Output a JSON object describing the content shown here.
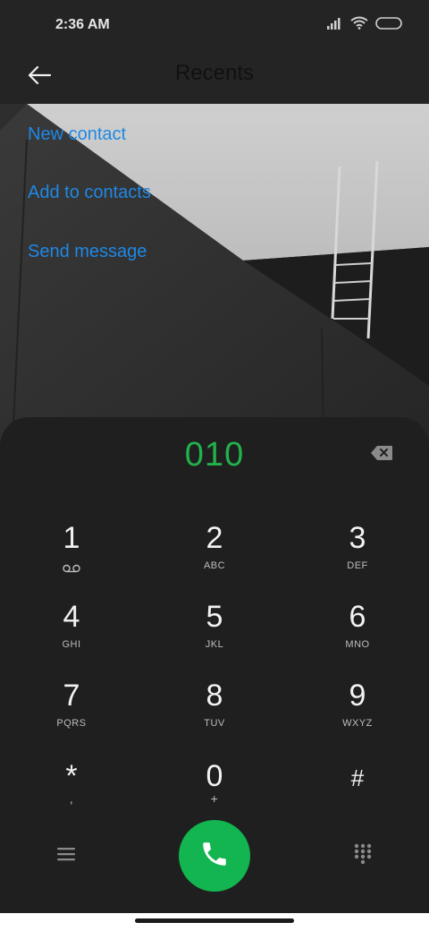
{
  "status_bar": {
    "time": "2:36 AM",
    "icons": [
      "signal-icon",
      "wifi-icon",
      "battery-icon"
    ]
  },
  "app_bar": {
    "title": "Recents",
    "back_icon": "back-arrow-icon"
  },
  "actions": {
    "new_contact": "New contact",
    "add_to_contacts": "Add to contacts",
    "send_message": "Send message"
  },
  "dialer": {
    "number": "010",
    "keys": [
      {
        "digit": "1",
        "sub": ""
      },
      {
        "digit": "2",
        "sub": "ABC"
      },
      {
        "digit": "3",
        "sub": "DEF"
      },
      {
        "digit": "4",
        "sub": "GHI"
      },
      {
        "digit": "5",
        "sub": "JKL"
      },
      {
        "digit": "6",
        "sub": "MNO"
      },
      {
        "digit": "7",
        "sub": "PQRS"
      },
      {
        "digit": "8",
        "sub": "TUV"
      },
      {
        "digit": "9",
        "sub": "WXYZ"
      },
      {
        "digit": "*",
        "sub": ","
      },
      {
        "digit": "0",
        "sub": "+"
      },
      {
        "digit": "#",
        "sub": ""
      }
    ]
  },
  "colors": {
    "link": "#1e88e5",
    "dialed_number": "#22b14c",
    "call_button": "#12b54f",
    "panel": "#1f1f1f"
  }
}
